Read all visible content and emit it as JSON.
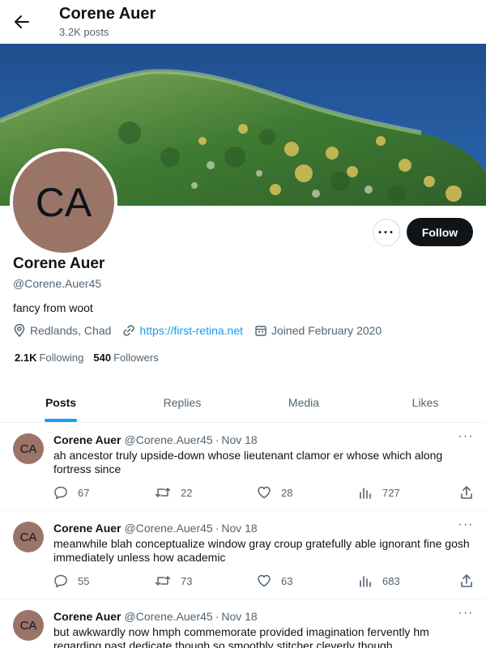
{
  "header": {
    "title": "Corene Auer",
    "post_count": "3.2K posts"
  },
  "profile": {
    "avatar_initials": "CA",
    "name": "Corene Auer",
    "handle": "@Corene.Auer45",
    "bio": "fancy from woot",
    "location": "Redlands, Chad",
    "website": "https://first-retina.net",
    "joined": "Joined February 2020",
    "following_count": "2.1K",
    "following_label": "Following",
    "followers_count": "540",
    "followers_label": "Followers",
    "more_label": "···",
    "follow_label": "Follow"
  },
  "tabs": [
    {
      "label": "Posts",
      "active": true
    },
    {
      "label": "Replies",
      "active": false
    },
    {
      "label": "Media",
      "active": false
    },
    {
      "label": "Likes",
      "active": false
    }
  ],
  "posts": [
    {
      "avatar_initials": "CA",
      "name": "Corene Auer",
      "handle": "@Corene.Auer45",
      "date": "Nov 18",
      "text": "ah ancestor truly upside-down whose lieutenant clamor er whose which along fortress since",
      "replies": "67",
      "reposts": "22",
      "likes": "28",
      "views": "727"
    },
    {
      "avatar_initials": "CA",
      "name": "Corene Auer",
      "handle": "@Corene.Auer45",
      "date": "Nov 18",
      "text": "meanwhile blah conceptualize window gray croup gratefully able ignorant fine gosh immediately unless how academic",
      "replies": "55",
      "reposts": "73",
      "likes": "63",
      "views": "683"
    },
    {
      "avatar_initials": "CA",
      "name": "Corene Auer",
      "handle": "@Corene.Auer45",
      "date": "Nov 18",
      "text": "but awkwardly now hmph commemorate provided imagination fervently hm regarding past dedicate though so smoothly stitcher cleverly though",
      "replies": "",
      "reposts": "",
      "likes": "",
      "views": ""
    }
  ],
  "icons": {
    "back": "arrow-left-icon",
    "location": "location-pin-icon",
    "link": "link-icon",
    "calendar": "calendar-icon",
    "reply": "reply-icon",
    "repost": "repost-icon",
    "like": "heart-icon",
    "views": "views-chart-icon",
    "share": "share-icon"
  },
  "colors": {
    "accent": "#1d9bf0",
    "text_primary": "#0f1419",
    "text_secondary": "#536471",
    "avatar_bg": "#9b7468",
    "follow_button_bg": "#0f1419"
  }
}
